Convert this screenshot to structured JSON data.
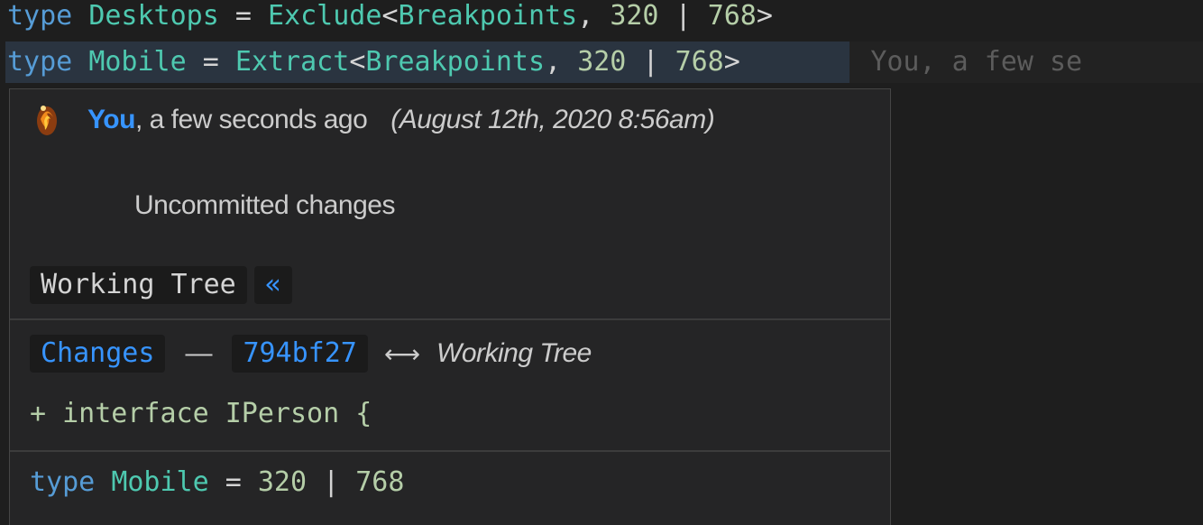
{
  "editor": {
    "line1": {
      "kw": "type",
      "name": "Desktops",
      "eq": "=",
      "util": "Exclude",
      "lt": "<",
      "param": "Breakpoints",
      "comma": ",",
      "n1": "320",
      "pipe": "|",
      "n2": "768",
      "gt": ">"
    },
    "line2": {
      "kw": "type",
      "name": "Mobile",
      "eq": "=",
      "util": "Extract",
      "lt": "<",
      "param": "Breakpoints",
      "comma": ",",
      "n1": "320",
      "pipe": "|",
      "n2": "768",
      "gt": ">",
      "blame": "You, a few se"
    }
  },
  "hover": {
    "author": "You",
    "relative_time": ", a few seconds ago",
    "date": "(August 12th, 2020 8:56am)",
    "message": "Uncommitted changes",
    "working_tree_label": "Working Tree",
    "working_tree_icon": "«",
    "changes_label": "Changes",
    "dash": "—",
    "commit_sha": "794bf27",
    "arrow": "⟷",
    "compare_target": "Working Tree",
    "diff_line": "+ interface IPerson {",
    "type_def": {
      "kw": "type",
      "name": "Mobile",
      "eq": "=",
      "n1": "320",
      "pipe": "|",
      "n2": "768"
    }
  },
  "colors": {
    "background": "#1e1e1e",
    "keyword": "#569cd6",
    "type": "#4ec9b0",
    "number": "#b5cea8",
    "link": "#3794ff",
    "hover_bg": "#252526"
  }
}
